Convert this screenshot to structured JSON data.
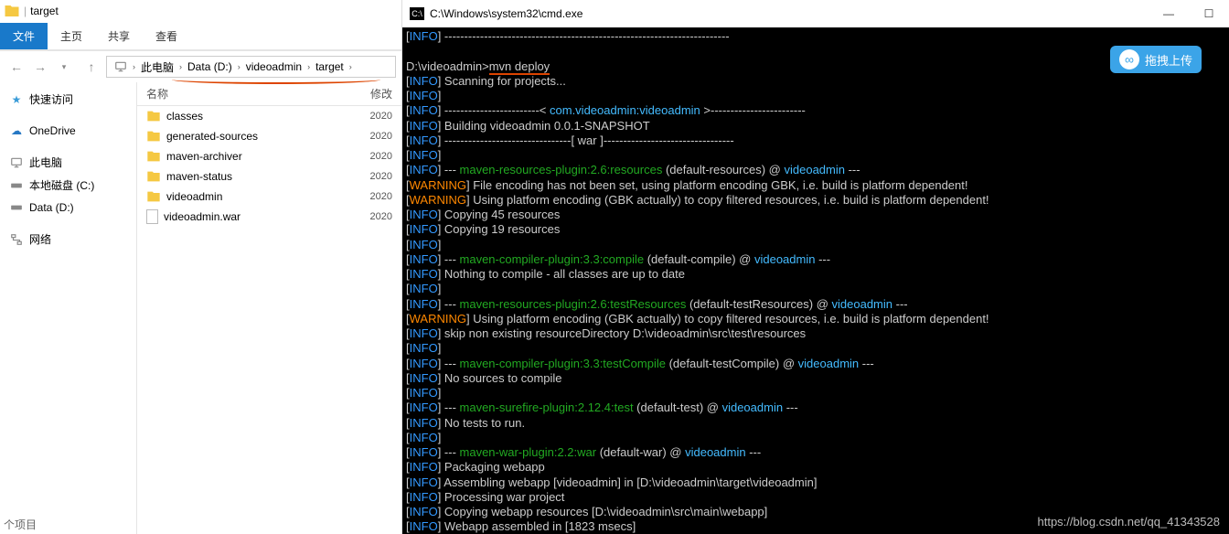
{
  "explorer": {
    "title": "target",
    "tabs": {
      "file": "文件",
      "home": "主页",
      "share": "共享",
      "view": "查看"
    },
    "breadcrumb": [
      "此电脑",
      "Data (D:)",
      "videoadmin",
      "target"
    ],
    "sidebar": {
      "quick": "快速访问",
      "onedrive": "OneDrive",
      "thispc": "此电脑",
      "localc": "本地磁盘 (C:)",
      "datad": "Data (D:)",
      "network": "网络"
    },
    "list_header": {
      "name": "名称",
      "modified": "修改"
    },
    "files": [
      {
        "name": "classes",
        "type": "folder",
        "date": "2020"
      },
      {
        "name": "generated-sources",
        "type": "folder",
        "date": "2020"
      },
      {
        "name": "maven-archiver",
        "type": "folder",
        "date": "2020"
      },
      {
        "name": "maven-status",
        "type": "folder",
        "date": "2020"
      },
      {
        "name": "videoadmin",
        "type": "folder",
        "date": "2020"
      },
      {
        "name": "videoadmin.war",
        "type": "file",
        "date": "2020"
      }
    ],
    "footer": "个项目"
  },
  "cmd": {
    "title": "C:\\Windows\\system32\\cmd.exe",
    "prompt": "D:\\videoadmin>",
    "command": "mvn deploy",
    "lines": [
      {
        "tag": "INFO",
        "text": " ------------------------------------------------------------------------"
      },
      {
        "raw": ""
      },
      {
        "prompt": true
      },
      {
        "tag": "INFO",
        "text": " Scanning for projects..."
      },
      {
        "tag": "INFO",
        "text": ""
      },
      {
        "tag": "INFO",
        "text": " ------------------------< ",
        "cyan": "com.videoadmin:videoadmin",
        "after": " >------------------------"
      },
      {
        "tag": "INFO",
        "text": " Building videoadmin 0.0.1-SNAPSHOT"
      },
      {
        "tag": "INFO",
        "text": " --------------------------------[ war ]---------------------------------"
      },
      {
        "tag": "INFO",
        "text": ""
      },
      {
        "tag": "INFO",
        "text": " --- ",
        "green": "maven-resources-plugin:2.6:resources",
        "after": " (default-resources) @ ",
        "cyan2": "videoadmin",
        "after2": " ---"
      },
      {
        "tag": "WARNING",
        "text": " File encoding has not been set, using platform encoding GBK, i.e. build is platform dependent!"
      },
      {
        "tag": "WARNING",
        "text": " Using platform encoding (GBK actually) to copy filtered resources, i.e. build is platform dependent!"
      },
      {
        "tag": "INFO",
        "text": " Copying 45 resources"
      },
      {
        "tag": "INFO",
        "text": " Copying 19 resources"
      },
      {
        "tag": "INFO",
        "text": ""
      },
      {
        "tag": "INFO",
        "text": " --- ",
        "green": "maven-compiler-plugin:3.3:compile",
        "after": " (default-compile) @ ",
        "cyan2": "videoadmin",
        "after2": " ---"
      },
      {
        "tag": "INFO",
        "text": " Nothing to compile - all classes are up to date"
      },
      {
        "tag": "INFO",
        "text": ""
      },
      {
        "tag": "INFO",
        "text": " --- ",
        "green": "maven-resources-plugin:2.6:testResources",
        "after": " (default-testResources) @ ",
        "cyan2": "videoadmin",
        "after2": " ---"
      },
      {
        "tag": "WARNING",
        "text": " Using platform encoding (GBK actually) to copy filtered resources, i.e. build is platform dependent!"
      },
      {
        "tag": "INFO",
        "text": " skip non existing resourceDirectory D:\\videoadmin\\src\\test\\resources"
      },
      {
        "tag": "INFO",
        "text": ""
      },
      {
        "tag": "INFO",
        "text": " --- ",
        "green": "maven-compiler-plugin:3.3:testCompile",
        "after": " (default-testCompile) @ ",
        "cyan2": "videoadmin",
        "after2": " ---"
      },
      {
        "tag": "INFO",
        "text": " No sources to compile"
      },
      {
        "tag": "INFO",
        "text": ""
      },
      {
        "tag": "INFO",
        "text": " --- ",
        "green": "maven-surefire-plugin:2.12.4:test",
        "after": " (default-test) @ ",
        "cyan2": "videoadmin",
        "after2": " ---"
      },
      {
        "tag": "INFO",
        "text": " No tests to run."
      },
      {
        "tag": "INFO",
        "text": ""
      },
      {
        "tag": "INFO",
        "text": " --- ",
        "green": "maven-war-plugin:2.2:war",
        "after": " (default-war) @ ",
        "cyan2": "videoadmin",
        "after2": " ---"
      },
      {
        "tag": "INFO",
        "text": " Packaging webapp"
      },
      {
        "tag": "INFO",
        "text": " Assembling webapp [videoadmin] in [D:\\videoadmin\\target\\videoadmin]"
      },
      {
        "tag": "INFO",
        "text": " Processing war project"
      },
      {
        "tag": "INFO",
        "text": " Copying webapp resources [D:\\videoadmin\\src\\main\\webapp]"
      },
      {
        "tag": "INFO",
        "text": " Webapp assembled in [1823 msecs]"
      }
    ]
  },
  "upload_label": "拖拽上传",
  "watermark": "https://blog.csdn.net/qq_41343528"
}
